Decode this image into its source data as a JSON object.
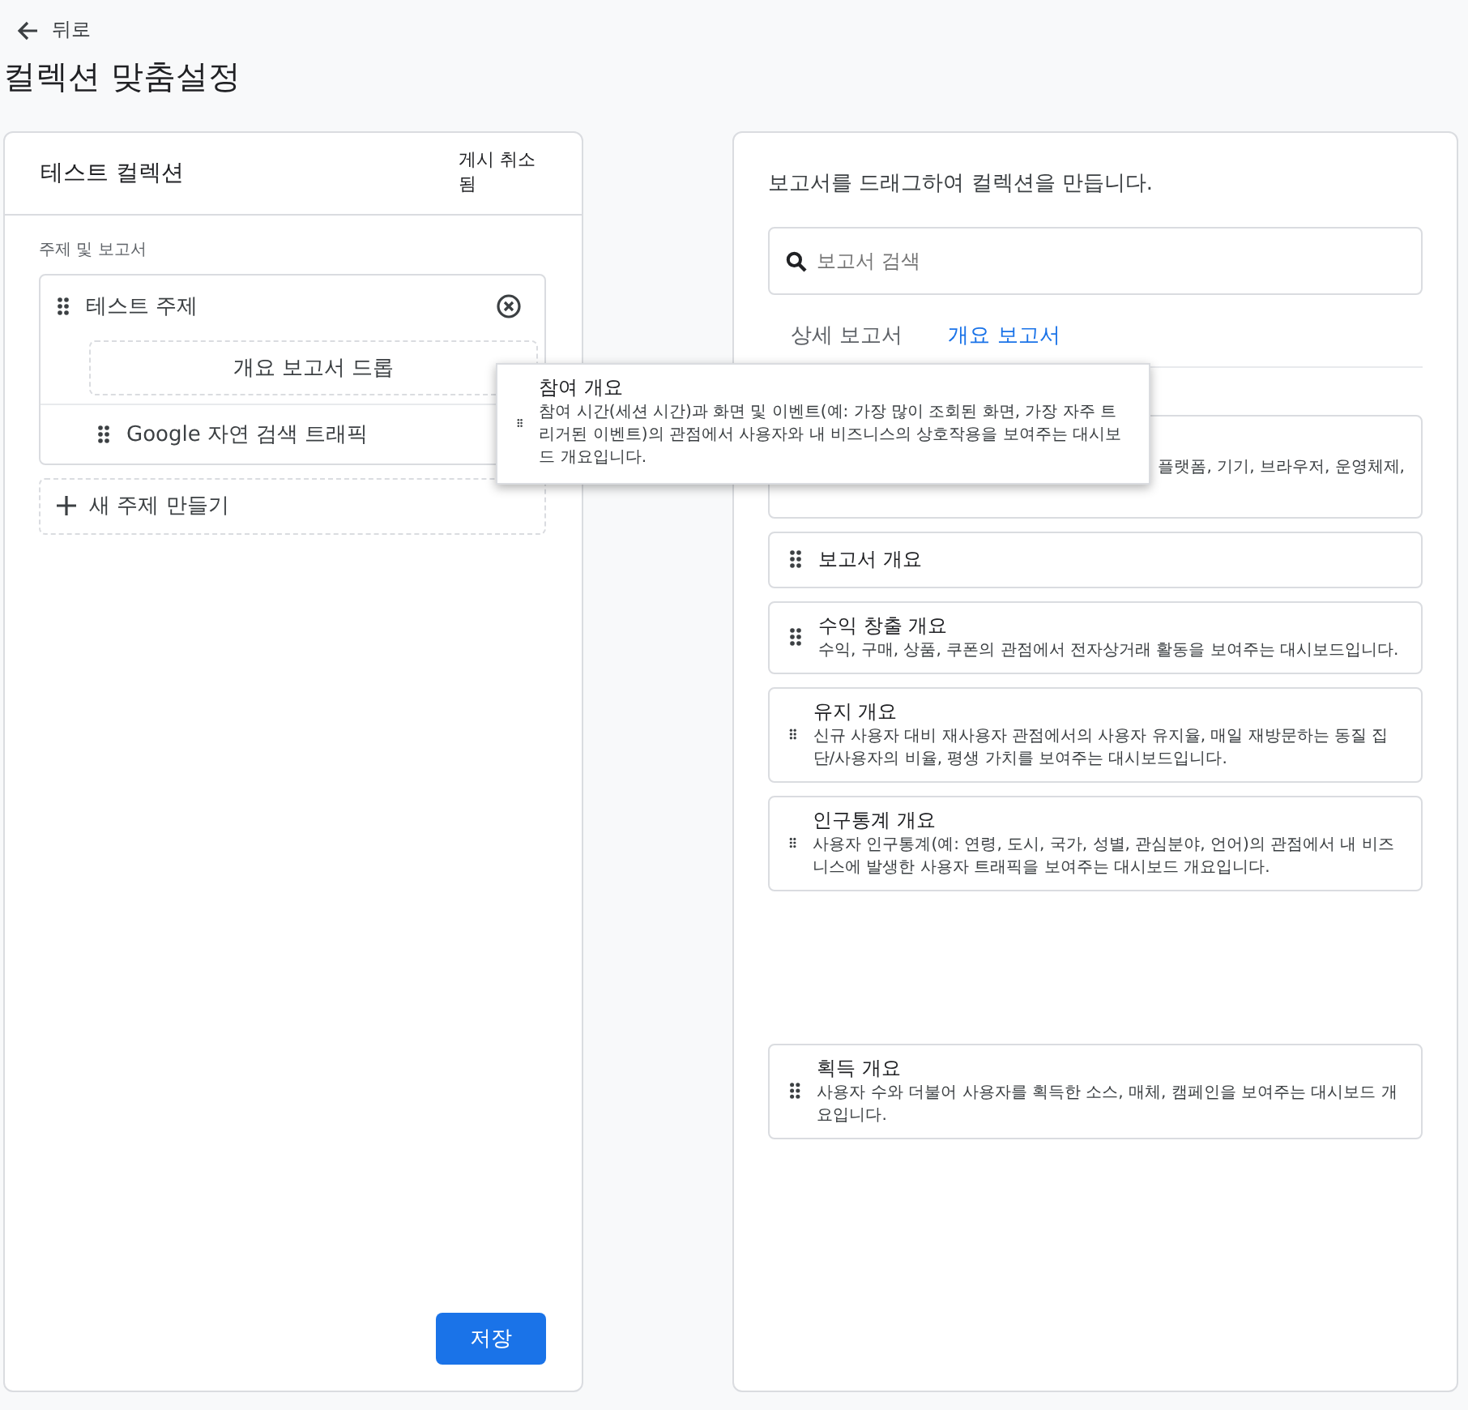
{
  "back": {
    "label": "뒤로"
  },
  "title": "컬렉션 맞춤설정",
  "collection": {
    "name": "테스트 컬렉션",
    "status": "게시 취소됨",
    "section_label": "주제 및 보고서",
    "topics": [
      {
        "name": "테스트 주제",
        "drop_zone": "개요 보고서 드롭",
        "reports": [
          {
            "name": "Google 자연 검색 트래픽"
          }
        ]
      }
    ],
    "new_topic": "새 주제 만들기",
    "save": "저장"
  },
  "library": {
    "instruction": "보고서를 드래그하여 컬렉션을 만듭니다.",
    "search": {
      "placeholder": "보고서 검색"
    },
    "tabs": [
      {
        "label": "상세 보고서",
        "selected": false
      },
      {
        "label": "개요 보고서",
        "selected": true
      }
    ],
    "reports": [
      {
        "kind": "covered",
        "description": "플랫폼, 기기, 브라우저, 운영체제,"
      },
      {
        "kind": "title_only",
        "title": "보고서 개요"
      },
      {
        "kind": "full",
        "title": "수익 창출 개요",
        "description": "수익, 구매, 상품, 쿠폰의 관점에서 전자상거래 활동을 보여주는 대시보드입니다."
      },
      {
        "kind": "full",
        "title": "유지 개요",
        "description": "신규 사용자 대비 재사용자 관점에서의 사용자 유지율, 매일 재방문하는 동질 집단/사용자의 비율, 평생 가치를 보여주는 대시보드입니다."
      },
      {
        "kind": "full",
        "title": "인구통계 개요",
        "description": "사용자 인구통계(예: 연령, 도시, 국가, 성별, 관심분야, 언어)의 관점에서 내 비즈니스에 발생한 사용자 트래픽을 보여주는 대시보드 개요입니다."
      },
      {
        "kind": "full",
        "title": "획득 개요",
        "description": "사용자 수와 더불어 사용자를 획득한 소스, 매체, 캠페인을 보여주는 대시보드 개요입니다."
      }
    ],
    "dragging": {
      "title": "참여 개요",
      "description": "참여 시간(세션 시간)과 화면 및 이벤트(예: 가장 많이 조회된 화면, 가장 자주 트리거된 이벤트)의 관점에서 사용자와 내 비즈니스의 상호작용을 보여주는 대시보드 개요입니다."
    }
  }
}
